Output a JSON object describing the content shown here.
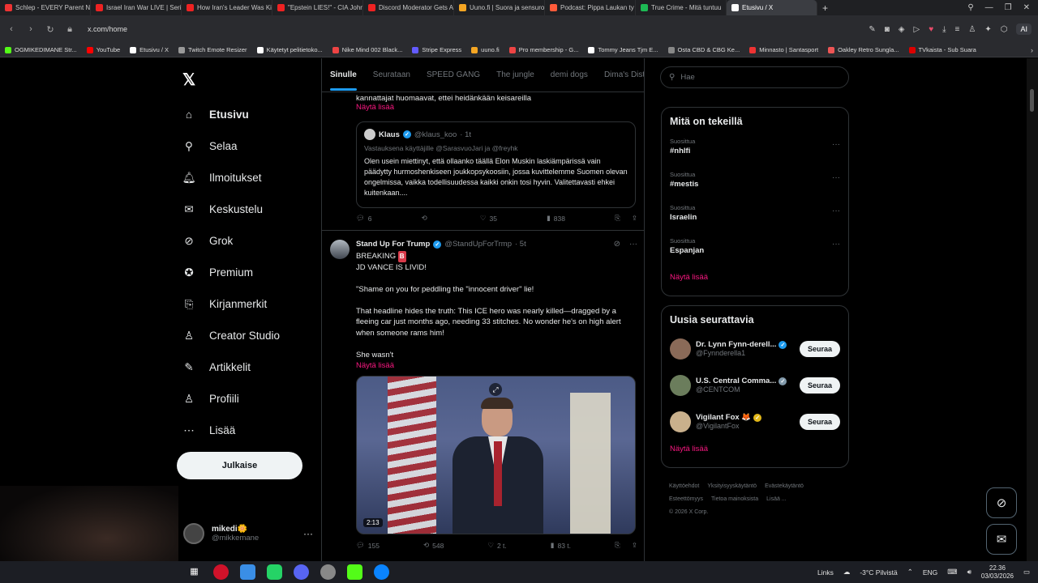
{
  "browser": {
    "tabs": [
      {
        "title": "Schlep - EVERY Parent Ne",
        "color": "#e33"
      },
      {
        "title": "Israel Iran War LIVE | Serie",
        "color": "#e22"
      },
      {
        "title": "How Iran's Leader Was Kill",
        "color": "#e22"
      },
      {
        "title": "\"Epstein LIES!\" - CIA John",
        "color": "#e22"
      },
      {
        "title": "Discord Moderator Gets A",
        "color": "#e22"
      },
      {
        "title": "Uuno.fi | Suora ja sensuro",
        "color": "#f5a623"
      },
      {
        "title": "Podcast: Pippa Laukan ty",
        "color": "#ff5b3a"
      },
      {
        "title": "True Crime - Mitä tuntuu",
        "color": "#1db954"
      },
      {
        "title": "Etusivu / X",
        "color": "#fff",
        "active": true
      }
    ],
    "new_tab": "+",
    "url": "x.com/home",
    "ai_label": "AI",
    "bookmarks": [
      {
        "label": "OGMIKEDIMANE Str...",
        "color": "#53fc18"
      },
      {
        "label": "YouTube",
        "color": "#f00"
      },
      {
        "label": "Etusivu / X",
        "color": "#fff"
      },
      {
        "label": "Twitch Emote Resizer",
        "color": "#999"
      },
      {
        "label": "Käytetyt pelitietoko...",
        "color": "#fff"
      },
      {
        "label": "Nike Mind 002 Black...",
        "color": "#e44"
      },
      {
        "label": "Stripe Express",
        "color": "#635bff"
      },
      {
        "label": "uuno.fi",
        "color": "#f5a623"
      },
      {
        "label": "Pro membership - G...",
        "color": "#e44"
      },
      {
        "label": "Tommy Jeans Tjm E...",
        "color": "#fff"
      },
      {
        "label": "Osta CBD & CBG Ke...",
        "color": "#888"
      },
      {
        "label": "Minnasto | Santasport",
        "color": "#e33"
      },
      {
        "label": "Oakley Retro Sungla...",
        "color": "#e55"
      },
      {
        "label": "TVkaista - Sub Suara",
        "color": "#d00"
      }
    ]
  },
  "nav": {
    "items": [
      {
        "label": "Etusivu",
        "icon": "home-icon",
        "bold": true,
        "glyph": "⌂"
      },
      {
        "label": "Selaa",
        "icon": "search-icon",
        "glyph": "⚲"
      },
      {
        "label": "Ilmoitukset",
        "icon": "bell-icon",
        "glyph": "🔔︎"
      },
      {
        "label": "Keskustelu",
        "icon": "mail-icon",
        "glyph": "✉"
      },
      {
        "label": "Grok",
        "icon": "grok-icon",
        "glyph": "⊘"
      },
      {
        "label": "Premium",
        "icon": "premium-icon",
        "glyph": "✪"
      },
      {
        "label": "Kirjanmerkit",
        "icon": "bookmark-icon",
        "glyph": "⎘"
      },
      {
        "label": "Creator Studio",
        "icon": "creator-icon",
        "glyph": "♙"
      },
      {
        "label": "Artikkelit",
        "icon": "article-icon",
        "glyph": "✎"
      },
      {
        "label": "Profiili",
        "icon": "profile-icon",
        "glyph": "♙"
      },
      {
        "label": "Lisää",
        "icon": "more-icon",
        "glyph": "⋯"
      }
    ],
    "post_label": "Julkaise",
    "account": {
      "name": "mikedi🌼",
      "handle": "@mikkemane"
    }
  },
  "feed": {
    "tabs": [
      "Sinulle",
      "Seurataan",
      "SPEED GANG",
      "The jungle",
      "demi dogs",
      "Dima's Dist"
    ],
    "post1": {
      "partial_text": "kannattajat huomaavat, ettei heidänkään keisareilla",
      "show_more": "Näytä lisää",
      "quote": {
        "name": "Klaus",
        "handle": "@klaus_koo",
        "time": "· 1t",
        "reply_to": "Vastauksena käyttäjille @SarasvuoJari ja @freyhk",
        "text": "Olen usein miettinyt, että ollaanko täällä Elon Muskin laskiämpärissä vain päädytty hurmoshenkiseen joukkopsykoosiin, jossa kuvittelemme Suomen olevan ongelmissa, vaikka todellisuudessa kaikki onkin tosi hyvin. Valitettavasti ehkei kuitenkaan...."
      },
      "actions": {
        "replies": "6",
        "reposts": "",
        "likes": "35",
        "views": "838"
      }
    },
    "post2": {
      "name": "Stand Up For Trump",
      "handle": "@StandUpForTrmp",
      "time": "· 5t",
      "line1": "BREAKING",
      "badge": "B",
      "line2": "JD VANCE IS LIVID!",
      "para1": "\"Shame on you for peddling the \"innocent driver\" lie!",
      "para2": "That headline hides the truth: This ICE hero was nearly killed—dragged by a fleeing car just months ago, needing 33 stitches. No wonder he's on high alert when someone rams him!",
      "para3": "She wasn't",
      "show_more": "Näytä lisää",
      "video_duration": "2:13",
      "actions": {
        "replies": "155",
        "reposts": "548",
        "likes": "2 t.",
        "views": "83 t."
      }
    }
  },
  "right": {
    "search_placeholder": "Hae",
    "trending_title": "Mitä on tekeillä",
    "trends": [
      {
        "sub": "Suosittua",
        "name": "#nhlfi"
      },
      {
        "sub": "Suosittua",
        "name": "#mestis"
      },
      {
        "sub": "Suosittua",
        "name": "Israelin"
      },
      {
        "sub": "Suosittua",
        "name": "Espanjan"
      }
    ],
    "trending_more": "Näytä lisää",
    "follow_title": "Uusia seurattavia",
    "follows": [
      {
        "name": "Dr. Lynn Fynn-derell...",
        "handle": "@Fynnderella1",
        "avatar": "#8a6a58",
        "badge": "blue"
      },
      {
        "name": "U.S. Central Comma...",
        "handle": "@CENTCOM",
        "avatar": "#6b7d5c",
        "badge": "grey"
      },
      {
        "name": "Vigilant Fox 🦊",
        "handle": "@VigilantFox",
        "avatar": "#c9b08c",
        "badge": "gold"
      }
    ],
    "follow_button": "Seuraa",
    "follow_more": "Näytä lisää",
    "footer_links": [
      "Käyttöehdot",
      "Yksityisyyskäytäntö",
      "Evästekäytäntö",
      "Esteettömyys",
      "Tietoa mainoksista",
      "Lisää ..."
    ],
    "copyright": "© 2026 X Corp."
  },
  "taskbar": {
    "links": "Links",
    "weather": "-3°C Pilvistä",
    "lang": "ENG",
    "time": "22.36",
    "date": "03/03/2026"
  }
}
